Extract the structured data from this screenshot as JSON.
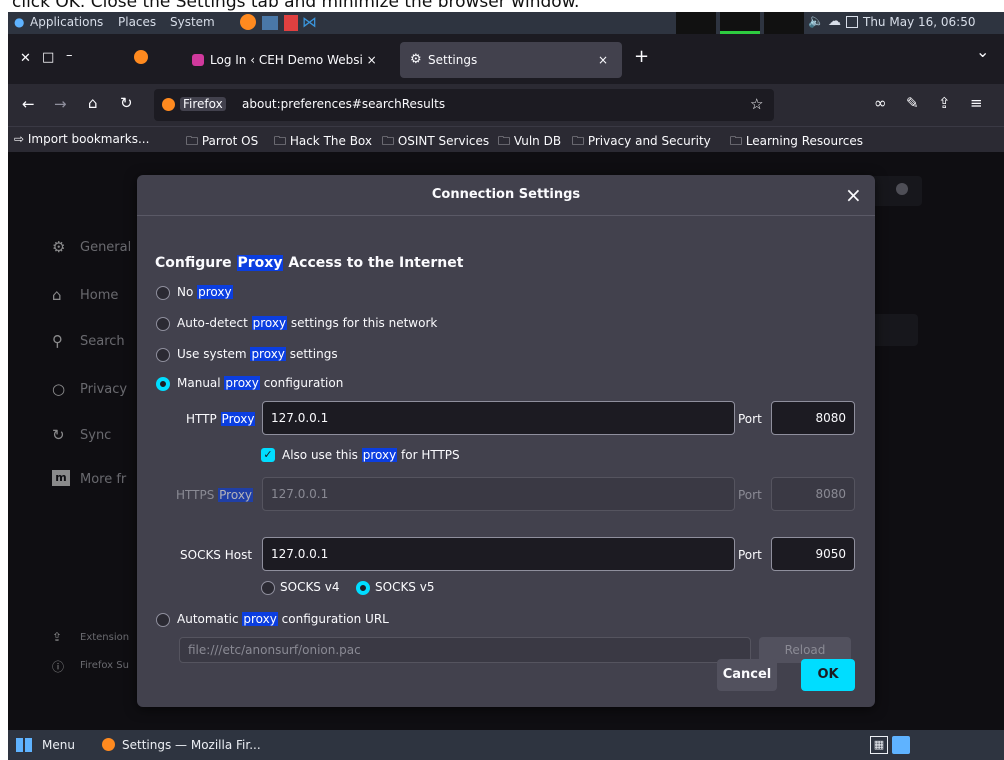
{
  "instruction": "click OK. Close the Settings tab and minimize the browser window.",
  "topbar": {
    "menus": [
      "Applications",
      "Places",
      "System"
    ],
    "clock": "Thu May 16, 06:50"
  },
  "tabs": [
    {
      "label": "Log In ‹ CEH Demo Websi ×",
      "active": false
    },
    {
      "label": "Settings",
      "active": true
    }
  ],
  "tab_controls": {
    "close_tab": "×",
    "new_tab": "+",
    "list_all": "⌄"
  },
  "navbar": {
    "identity": "Firefox",
    "url": "about:preferences#searchResults"
  },
  "bookmarks": [
    "Import bookmarks...",
    "Parrot OS",
    "Hack The Box",
    "OSINT Services",
    "Vuln DB",
    "Privacy and Security",
    "Learning Resources"
  ],
  "sidebar": {
    "items": [
      "General",
      "Home",
      "Search",
      "Privacy",
      "Sync",
      "More fr"
    ],
    "bottom": [
      "Extension",
      "Firefox Su"
    ]
  },
  "dialog": {
    "title": "Connection Settings",
    "close": "×",
    "heading_pre": "Configure ",
    "heading_hl": "Proxy",
    "heading_post": " Access to the Internet",
    "options": [
      {
        "pre": "No ",
        "hl": "proxy",
        "post": "",
        "selected": false
      },
      {
        "pre": "Auto-detect ",
        "hl": "proxy",
        "post": " settings for this network",
        "selected": false
      },
      {
        "pre": "Use system ",
        "hl": "proxy",
        "post": " settings",
        "selected": false
      },
      {
        "pre": "Manual ",
        "hl": "proxy",
        "post": " configuration",
        "selected": true
      }
    ],
    "http_label": "HTTP",
    "http_label_hl": "Proxy",
    "http_value": "127.0.0.1",
    "http_port_label": "Port",
    "http_port": "8080",
    "also_https_pre": "Also use this ",
    "also_https_hl": "proxy",
    "also_https_post": " for HTTPS",
    "https_label": "HTTPS",
    "https_label_hl": "Proxy",
    "https_value": "127.0.0.1",
    "https_port_label": "Port",
    "https_port": "8080",
    "socks_label": "SOCKS Host",
    "socks_value": "127.0.0.1",
    "socks_port_label": "Port",
    "socks_port": "9050",
    "socks_v4": "SOCKS v4",
    "socks_v5": "SOCKS v5",
    "auto_url_pre": "Automatic ",
    "auto_url_hl": "proxy",
    "auto_url_post": " configuration URL",
    "auto_url_value": "file:///etc/anonsurf/onion.pac",
    "reload": "Reload",
    "cancel": "Cancel",
    "ok": "OK"
  },
  "taskbar": {
    "menu": "Menu",
    "window": "Settings — Mozilla Fir..."
  },
  "colors": {
    "accent": "#00ddff",
    "highlight": "#0b3ee0",
    "dialog_bg": "#42414d"
  }
}
